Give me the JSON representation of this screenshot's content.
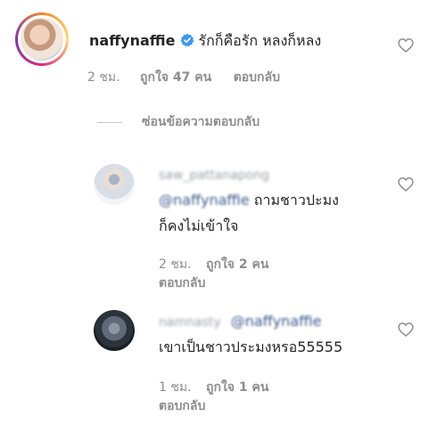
{
  "main_comment": {
    "username": "naffynaffie",
    "text": "รักก็คือรัก หลงก็หลง",
    "time": "2 ชม.",
    "likes": "ถูกใจ 47 คน",
    "reply_label": "ตอบกลับ"
  },
  "hide_replies_label": "ซ่อนข้อความตอบกลับ",
  "replies": [
    {
      "username": "saw_pattanapong",
      "mention": "@naffynaffie",
      "text_line1": "ถามชาวปะมง",
      "text_line2": "ก็คงไม่เข้าใจ",
      "time": "2 ชม.",
      "likes": "ถูกใจ 2 คน",
      "reply_label": "ตอบกลับ"
    },
    {
      "username": "namnasty",
      "mention": "@naffynaffie",
      "text_line1": "เขาเป็นชาวประมงหรอ55555",
      "time": "1 ชม.",
      "likes": "ถูกใจ 1 คน",
      "reply_label": "ตอบกลับ"
    }
  ],
  "icons": {
    "verified": "verified-badge-icon",
    "heart": "heart-outline-icon"
  },
  "colors": {
    "verified_blue": "#3897f0",
    "muted": "#8e8e8e",
    "text": "#262626"
  }
}
